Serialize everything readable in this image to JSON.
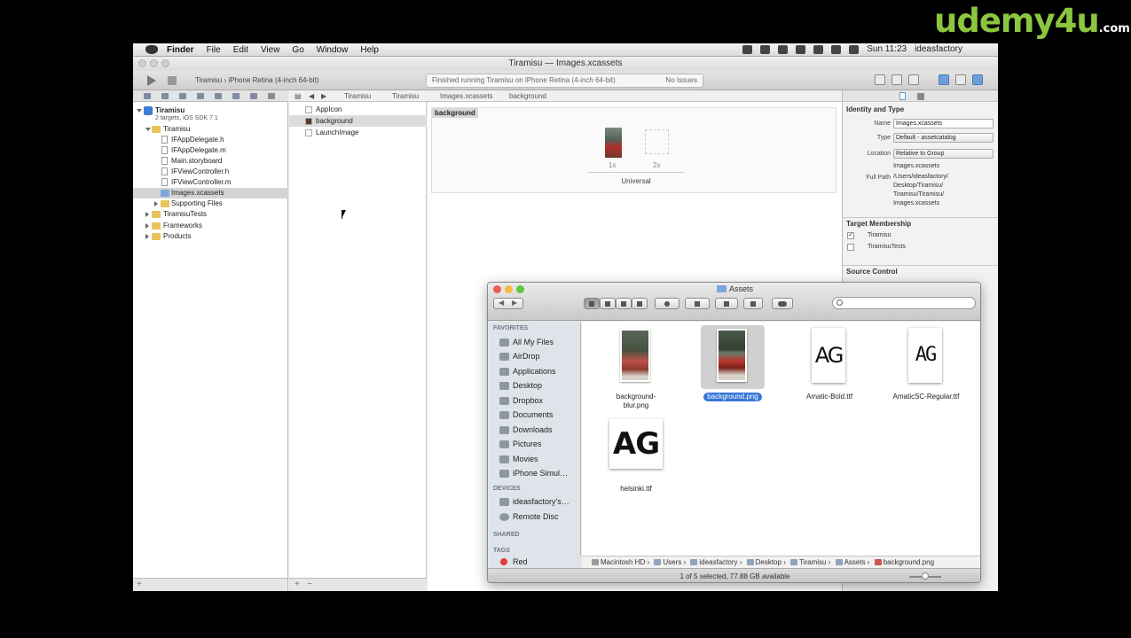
{
  "watermark": {
    "brand": "udemy4u",
    "suffix": ".com"
  },
  "menubar": {
    "app": "Finder",
    "items": [
      "File",
      "Edit",
      "View",
      "Go",
      "Window",
      "Help"
    ],
    "clock": "Sun 11:23",
    "user": "ideasfactory"
  },
  "xcode": {
    "window_title": "Tiramisu — Images.xcassets",
    "scheme": "Tiramisu",
    "device": "iPhone Retina (4-inch 64-bit)",
    "activity": "Finished running Tiramisu on iPhone Retina (4-inch 64-bit)",
    "issues": "No Issues",
    "jumpbar": [
      "Tiramisu",
      "Tiramisu",
      "Images.xcassets",
      "background"
    ],
    "navigator": [
      {
        "label": "Tiramisu",
        "level": 0,
        "kind": "project",
        "open": true
      },
      {
        "label": "2 targets, iOS SDK 7.1",
        "level": 0,
        "kind": "sub"
      },
      {
        "label": "Tiramisu",
        "level": 1,
        "kind": "folder",
        "open": true
      },
      {
        "label": "IFAppDelegate.h",
        "level": 2,
        "kind": "file"
      },
      {
        "label": "IFAppDelegate.m",
        "level": 2,
        "kind": "file"
      },
      {
        "label": "Main.storyboard",
        "level": 2,
        "kind": "file"
      },
      {
        "label": "IFViewController.h",
        "level": 2,
        "kind": "file"
      },
      {
        "label": "IFViewController.m",
        "level": 2,
        "kind": "file"
      },
      {
        "label": "Images.xcassets",
        "level": 2,
        "kind": "folder",
        "selected": true
      },
      {
        "label": "Supporting Files",
        "level": 2,
        "kind": "folder",
        "closed": true
      },
      {
        "label": "TiramisuTests",
        "level": 1,
        "kind": "folder",
        "closed": true
      },
      {
        "label": "Frameworks",
        "level": 1,
        "kind": "folder",
        "closed": true
      },
      {
        "label": "Products",
        "level": 1,
        "kind": "folder",
        "closed": true
      }
    ],
    "assets": [
      {
        "label": "AppIcon"
      },
      {
        "label": "background",
        "selected": true
      },
      {
        "label": "LaunchImage"
      }
    ],
    "editor": {
      "set_name": "background",
      "slot1": "1x",
      "slot2": "2x",
      "idiom": "Universal"
    },
    "inspector": {
      "identity_header": "Identity and Type",
      "name_label": "Name",
      "name_value": "Images.xcassets",
      "type_label": "Type",
      "type_value": "Default - assetcatalog",
      "location_label": "Location",
      "location_value": "Relative to Group",
      "location_file": "Images.xcassets",
      "fullpath_label": "Full Path",
      "fullpath_value": [
        "/Users/ideasfactory/",
        "Desktop/Tiramisu/",
        "Tiramisu/Tiramisu/",
        "Images.xcassets"
      ],
      "membership_header": "Target Membership",
      "targets": [
        {
          "label": "Tiramisu",
          "checked": true
        },
        {
          "label": "TiramisuTests",
          "checked": false
        }
      ],
      "source_header": "Source Control"
    }
  },
  "finder": {
    "title": "Assets",
    "sidebar": {
      "favorites_header": "FAVORITES",
      "favorites": [
        "All My Files",
        "AirDrop",
        "Applications",
        "Desktop",
        "Dropbox",
        "Documents",
        "Downloads",
        "Pictures",
        "Movies",
        "iPhone Simul…"
      ],
      "devices_header": "DEVICES",
      "devices": [
        "ideasfactory's…",
        "Remote Disc"
      ],
      "shared_header": "SHARED",
      "tags_header": "TAGS",
      "tags": [
        {
          "label": "Red",
          "color": "#e23c3c"
        }
      ]
    },
    "files": [
      {
        "name": "background-\nblur.png",
        "kind": "photo-blur"
      },
      {
        "name": "background.png",
        "kind": "photo",
        "selected": true
      },
      {
        "name": "Amatic-Bold.ttf",
        "kind": "font",
        "glyph": "AG"
      },
      {
        "name": "AmaticSC-Regular.ttf",
        "kind": "font-thin",
        "glyph": "AG"
      },
      {
        "name": "helsinki.ttf",
        "kind": "font-wide",
        "glyph": "AG"
      }
    ],
    "path": [
      "Macintosh HD",
      "Users",
      "ideasfactory",
      "Desktop",
      "Tiramisu",
      "Assets",
      "background.png"
    ],
    "status": "1 of 5 selected, 77.88 GB available",
    "accent": "#3875d7"
  }
}
